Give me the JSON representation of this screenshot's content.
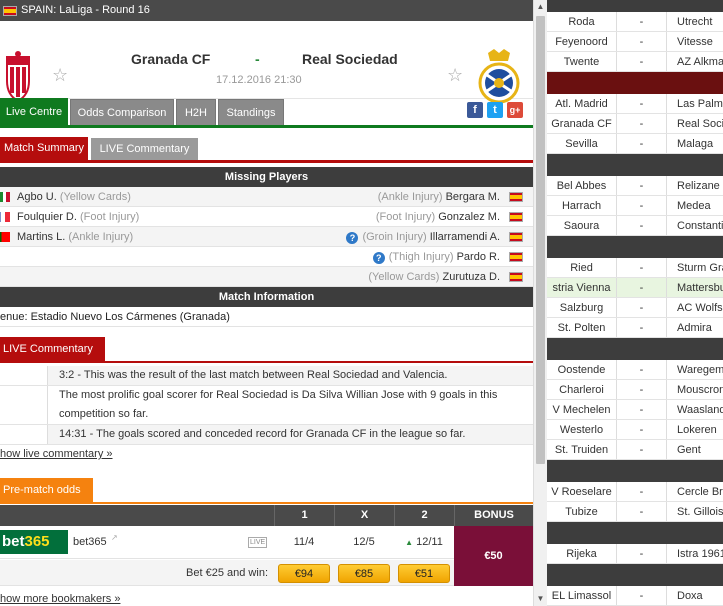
{
  "header": {
    "league": "SPAIN: LaLiga - Round 16"
  },
  "match": {
    "home": "Granada CF",
    "away": "Real Sociedad",
    "separator": "-",
    "datetime": "17.12.2016 21:30",
    "star": "☆"
  },
  "tabs": [
    "Live Centre",
    "Odds Comparison",
    "H2H",
    "Standings"
  ],
  "social": {
    "facebook": "f",
    "twitter": "t",
    "google": "g+"
  },
  "subtabs": [
    "Match Summary",
    "LIVE Commentary"
  ],
  "missing": {
    "title": "Missing Players",
    "rows": [
      {
        "home_player": "Agbo U.",
        "home_reason": "(Yellow Cards)",
        "away_reason": "(Ankle Injury)",
        "away_player": "Bergara M.",
        "question": ""
      },
      {
        "home_player": "Foulquier D.",
        "home_reason": "(Foot Injury)",
        "away_reason": "(Foot Injury)",
        "away_player": "Gonzalez M.",
        "question": ""
      },
      {
        "home_player": "Martins L.",
        "home_reason": "(Ankle Injury)",
        "away_reason": "(Groin Injury)",
        "away_player": "Illarramendi A.",
        "question": "?"
      },
      {
        "home_player": "",
        "home_reason": "",
        "away_reason": "(Thigh Injury)",
        "away_player": "Pardo R.",
        "question": "?"
      },
      {
        "home_player": "",
        "home_reason": "",
        "away_reason": "(Yellow Cards)",
        "away_player": "Zurutuza D.",
        "question": ""
      }
    ]
  },
  "info": {
    "title": "Match Information",
    "venue": "enue: Estadio Nuevo Los Cármenes (Granada)"
  },
  "commentary": {
    "label": "LIVE Commentary",
    "lines": [
      "3:2 - This was the result of the last match between Real Sociedad and Valencia.",
      "The most prolific goal scorer for Real Sociedad is Da Silva Willian Jose with 9 goals in this competition so far.",
      "14:31 - The goals scored and conceded record for Granada CF in the league so far."
    ],
    "show_link": "how live commentary »"
  },
  "odds": {
    "label": "Pre-match odds",
    "headers": [
      "1",
      "X",
      "2",
      "BONUS"
    ],
    "bookmaker": {
      "logo_a": "bet",
      "logo_b": "365",
      "name": "bet365",
      "live": "LIVE"
    },
    "values": [
      "11/4",
      "12/5",
      "12/11"
    ],
    "up_marker": "▲",
    "bonus": "€50",
    "bet_text": "Bet €25 and win:",
    "wins": [
      "€94",
      "€85",
      "€51"
    ],
    "more_link": "how more bookmakers »"
  },
  "scrollbar": {
    "up": "▲",
    "down": "▼"
  },
  "background_list": [
    {
      "home": "Roda",
      "dash": "-",
      "away": "Utrecht"
    },
    {
      "home": "Feyenoord",
      "dash": "-",
      "away": "Vitesse"
    },
    {
      "home": "Twente",
      "dash": "-",
      "away": "AZ Alkmaar"
    },
    {
      "home": "Atl. Madrid",
      "dash": "-",
      "away": "Las Palmas"
    },
    {
      "home": "Granada CF",
      "dash": "-",
      "away": "Real Sociedad"
    },
    {
      "home": "Sevilla",
      "dash": "-",
      "away": "Malaga"
    },
    {
      "home": "Bel Abbes",
      "dash": "-",
      "away": "Relizane"
    },
    {
      "home": "Harrach",
      "dash": "-",
      "away": "Medea"
    },
    {
      "home": "Saoura",
      "dash": "-",
      "away": "Constantine"
    },
    {
      "home": "Ried",
      "dash": "-",
      "away": "Sturm Graz"
    },
    {
      "home": "stria Vienna",
      "dash": "-",
      "away": "Mattersburg"
    },
    {
      "home": "Salzburg",
      "dash": "-",
      "away": "AC Wolfsberger"
    },
    {
      "home": "St. Polten",
      "dash": "-",
      "away": "Admira"
    },
    {
      "home": "Oostende",
      "dash": "-",
      "away": "Waregem"
    },
    {
      "home": "Charleroi",
      "dash": "-",
      "away": "Mouscron"
    },
    {
      "home": "V Mechelen",
      "dash": "-",
      "away": "Waasland"
    },
    {
      "home": "Westerlo",
      "dash": "-",
      "away": "Lokeren"
    },
    {
      "home": "St. Truiden",
      "dash": "-",
      "away": "Gent"
    },
    {
      "home": "V Roeselare",
      "dash": "-",
      "away": "Cercle Brugge"
    },
    {
      "home": "Tubize",
      "dash": "-",
      "away": "St. Gilloise"
    },
    {
      "home": "Rijeka",
      "dash": "-",
      "away": "Istra 1961"
    },
    {
      "home": "EL Limassol",
      "dash": "-",
      "away": "Doxa"
    }
  ]
}
